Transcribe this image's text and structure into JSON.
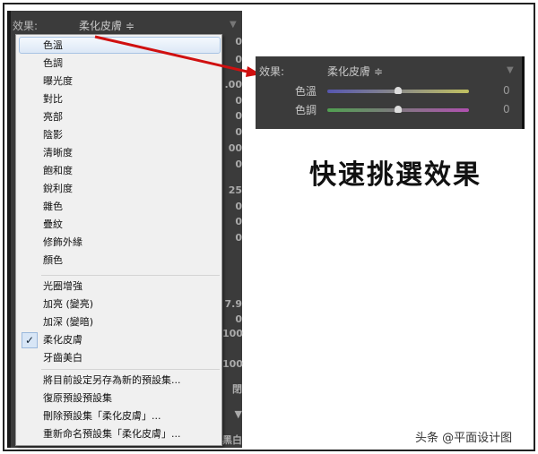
{
  "left_panel": {
    "effect_label": "效果:",
    "effect_value": "柔化皮膚 ≑",
    "right_values": [
      "0",
      "0",
      ".00",
      "0",
      "0",
      "0",
      "00",
      "0",
      "25",
      "0",
      "0",
      "0",
      "7.9",
      "0",
      "100",
      "100",
      "閉",
      "▼",
      "黑白"
    ]
  },
  "menu": {
    "group1": [
      "色溫",
      "色調",
      "曝光度",
      "對比",
      "亮部",
      "陰影",
      "清晰度",
      "飽和度",
      "銳利度",
      "雜色",
      "疊紋",
      "修飾外緣",
      "顏色"
    ],
    "group2": [
      "光圈增強",
      "加亮 (變亮)",
      "加深 (變暗)",
      "柔化皮膚",
      "牙齒美白"
    ],
    "checked": "✓",
    "group3": [
      "將目前設定另存為新的預設集...",
      "復原預設預設集",
      "刪除預設集「柔化皮膚」...",
      "重新命名預設集「柔化皮膚」..."
    ]
  },
  "right_panel": {
    "effect_label": "效果:",
    "effect_value": "柔化皮膚 ≑",
    "rows": [
      {
        "label": "色溫",
        "value": "0",
        "position": 0.5
      },
      {
        "label": "色調",
        "value": "0",
        "position": 0.5
      }
    ]
  },
  "caption": "快速挑選效果",
  "watermark": "头条 @平面设计图",
  "colors": {
    "arrow": "#d01010",
    "panel": "#3b3b3b"
  }
}
